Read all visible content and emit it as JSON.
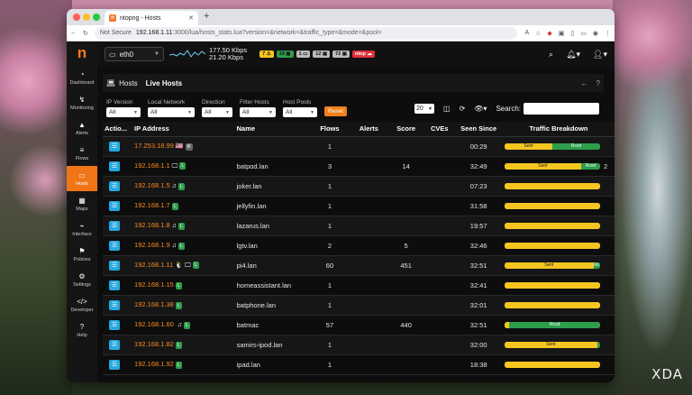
{
  "browser": {
    "tab_title": "ntopng - Hosts",
    "url_security": "Not Secure",
    "url_host": "192.168.1.11",
    "url_path": ":3000/lua/hosts_stats.lua?version=&network=&traffic_type=&mode=&pool=",
    "reader_label": "A"
  },
  "sidebar": {
    "logo": "n",
    "items": [
      {
        "label": "Dashboard",
        "icon": "dashboard-icon"
      },
      {
        "label": "Monitoring",
        "icon": "monitoring-icon"
      },
      {
        "label": "Alerts",
        "icon": "alerts-icon"
      },
      {
        "label": "Flows",
        "icon": "flows-icon"
      },
      {
        "label": "Hosts",
        "icon": "hosts-icon"
      },
      {
        "label": "Maps",
        "icon": "maps-icon"
      },
      {
        "label": "Interface",
        "icon": "interface-icon"
      },
      {
        "label": "Policies",
        "icon": "policies-icon"
      },
      {
        "label": "Settings",
        "icon": "settings-icon"
      },
      {
        "label": "Developer",
        "icon": "developer-icon"
      },
      {
        "label": "Help",
        "icon": "help-icon"
      }
    ]
  },
  "topbar": {
    "interface": "eth0",
    "rate_down": "177.50 Kbps",
    "rate_up": "21.20 Kbps",
    "badges": [
      {
        "text": "7 ⚠",
        "color": "#f6c620"
      },
      {
        "text": "19 ▣",
        "color": "#2e9e4d"
      },
      {
        "text": "1 ▭",
        "color": "#bbbbbb"
      },
      {
        "text": "12 ▣",
        "color": "#bbbbbb"
      },
      {
        "text": "72 ▣",
        "color": "#bbbbbb"
      },
      {
        "text": "ntop ☁",
        "color": "#e0303a"
      }
    ]
  },
  "page": {
    "hosts_label": "Hosts",
    "live_label": "Live Hosts"
  },
  "filters": [
    {
      "label": "IP Version",
      "value": "All"
    },
    {
      "label": "Local Network",
      "value": "All"
    },
    {
      "label": "Direction",
      "value": "All"
    },
    {
      "label": "Filter Hosts",
      "value": "All"
    },
    {
      "label": "Host Pools",
      "value": "All"
    }
  ],
  "reset_label": "Reset",
  "page_size": "20",
  "search_label": "Search:",
  "table": {
    "headers": [
      "Actio...",
      "IP Address",
      "Name",
      "Flows",
      "Alerts",
      "Score",
      "CVEs",
      "Seen Since",
      "Traffic Breakdown"
    ],
    "rows": [
      {
        "ip": "17.253.18.99",
        "icons": "🇺🇸",
        "tag": "R",
        "name": "",
        "flows": "1",
        "alerts": "",
        "score": "",
        "seen": "00:29",
        "sent": 50,
        "rcvd": 50,
        "sent_label": "Sent",
        "rcvd_label": "Rcvd",
        "extra": ""
      },
      {
        "ip": "192.168.1.1",
        "icons": "🖵",
        "tag": "L",
        "name": "batpod.lan",
        "flows": "3",
        "alerts": "",
        "score": "14",
        "seen": "32:49",
        "sent": 80,
        "rcvd": 20,
        "sent_label": "Sent",
        "rcvd_label": "Rcvd",
        "extra": "2"
      },
      {
        "ip": "192.168.1.5",
        "icons": "♫",
        "tag": "L",
        "name": "joker.lan",
        "flows": "1",
        "alerts": "",
        "score": "",
        "seen": "07:23",
        "sent": 100,
        "rcvd": 0,
        "sent_label": "",
        "rcvd_label": "",
        "extra": ""
      },
      {
        "ip": "192.168.1.7",
        "icons": "",
        "tag": "L",
        "name": "jellyfin.lan",
        "flows": "1",
        "alerts": "",
        "score": "",
        "seen": "31:58",
        "sent": 100,
        "rcvd": 0,
        "sent_label": "",
        "rcvd_label": "",
        "extra": ""
      },
      {
        "ip": "192.168.1.8",
        "icons": "♫",
        "tag": "L",
        "name": "lazarus.lan",
        "flows": "1",
        "alerts": "",
        "score": "",
        "seen": "19:57",
        "sent": 100,
        "rcvd": 0,
        "sent_label": "",
        "rcvd_label": "",
        "extra": ""
      },
      {
        "ip": "192.168.1.9",
        "icons": "♫",
        "tag": "L",
        "name": "lgtv.lan",
        "flows": "2",
        "alerts": "",
        "score": "5",
        "seen": "32:46",
        "sent": 100,
        "rcvd": 0,
        "sent_label": "",
        "rcvd_label": "",
        "extra": ""
      },
      {
        "ip": "192.168.1.11",
        "icons": "🐧 🖵",
        "tag": "L",
        "name": "pi4.lan",
        "flows": "60",
        "alerts": "",
        "score": "451",
        "seen": "32:51",
        "sent": 93,
        "rcvd": 7,
        "sent_label": "Sent",
        "rcvd_label": "Rc",
        "extra": ""
      },
      {
        "ip": "192.168.1.15",
        "icons": "",
        "tag": "L",
        "name": "homeassistant.lan",
        "flows": "1",
        "alerts": "",
        "score": "",
        "seen": "32:41",
        "sent": 100,
        "rcvd": 0,
        "sent_label": "",
        "rcvd_label": "",
        "extra": ""
      },
      {
        "ip": "192.168.1.38",
        "icons": "",
        "tag": "L",
        "name": "batphone.lan",
        "flows": "1",
        "alerts": "",
        "score": "",
        "seen": "32:01",
        "sent": 100,
        "rcvd": 0,
        "sent_label": "",
        "rcvd_label": "",
        "extra": ""
      },
      {
        "ip": "192.168.1.60",
        "icons": " ♫",
        "tag": "L",
        "name": "batmac",
        "flows": "57",
        "alerts": "",
        "score": "440",
        "seen": "32:51",
        "sent": 5,
        "rcvd": 95,
        "sent_label": "",
        "rcvd_label": "Rcvd",
        "extra": ""
      },
      {
        "ip": "192.168.1.82",
        "icons": "",
        "tag": "L",
        "name": "samirs-ipod.lan",
        "flows": "1",
        "alerts": "",
        "score": "",
        "seen": "32:00",
        "sent": 97,
        "rcvd": 3,
        "sent_label": "Sent",
        "rcvd_label": "",
        "extra": ""
      },
      {
        "ip": "192.168.1.92",
        "icons": "",
        "tag": "L",
        "name": "ipad.lan",
        "flows": "1",
        "alerts": "",
        "score": "",
        "seen": "18:38",
        "sent": 100,
        "rcvd": 0,
        "sent_label": "",
        "rcvd_label": "",
        "extra": ""
      }
    ]
  },
  "watermark": "XDA"
}
